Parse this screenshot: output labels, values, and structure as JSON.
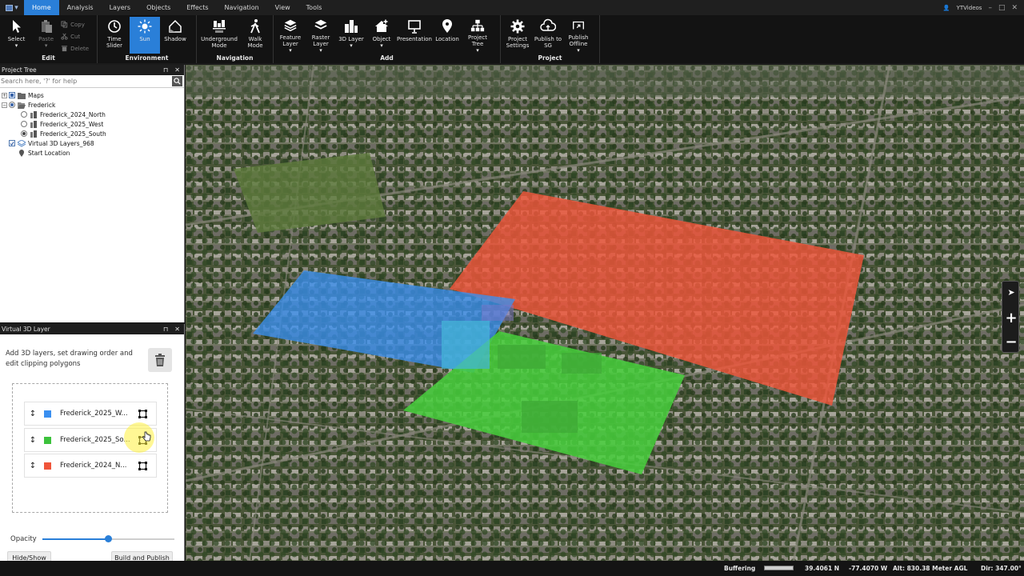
{
  "menu": {
    "tabs": [
      "Home",
      "Analysis",
      "Layers",
      "Objects",
      "Effects",
      "Navigation",
      "View",
      "Tools"
    ],
    "user": "YTVideos"
  },
  "ribbon": {
    "edit": {
      "label": "Edit",
      "select": "Select",
      "paste": "Paste",
      "copy": "Copy",
      "cut": "Cut",
      "delete": "Delete"
    },
    "environment": {
      "label": "Environment",
      "time_slider": "Time Slider",
      "sun": "Sun",
      "shadow": "Shadow"
    },
    "navigation": {
      "label": "Navigation",
      "underground": "Underground Mode",
      "walk": "Walk Mode"
    },
    "add": {
      "label": "Add",
      "feature_layer": "Feature Layer",
      "raster_layer": "Raster Layer",
      "layer_3d": "3D Layer",
      "object": "Object",
      "presentation": "Presentation",
      "location": "Location",
      "project_tree": "Project Tree"
    },
    "project": {
      "label": "Project",
      "settings": "Project Settings",
      "publish_sg": "Publish to SG",
      "publish_offline": "Publish Offline"
    }
  },
  "project_tree": {
    "title": "Project Tree",
    "search_placeholder": "Search here, '?' for help",
    "items": [
      {
        "label": "Maps"
      },
      {
        "label": "Frederick"
      },
      {
        "label": "Frederick_2024_North"
      },
      {
        "label": "Frederick_2025_West"
      },
      {
        "label": "Frederick_2025_South"
      },
      {
        "label": "Virtual 3D Layers_968"
      },
      {
        "label": "Start Location"
      }
    ]
  },
  "virtual_layer": {
    "title": "Virtual 3D Layer",
    "description": "Add 3D layers, set drawing order and edit clipping polygons",
    "layers": [
      {
        "name": "Frederick_2025_W...",
        "color": "#3a8ff0"
      },
      {
        "name": "Frederick_2025_So...",
        "color": "#3cc23c"
      },
      {
        "name": "Frederick_2024_N...",
        "color": "#f0553a"
      }
    ],
    "opacity_label": "Opacity",
    "opacity_value": 0.5,
    "hide_show": "Hide/Show",
    "build_publish": "Build and Publish"
  },
  "status": {
    "buffering": "Buffering",
    "lat": "39.4061 N",
    "lon": "-77.4070 W",
    "alt": "Alt: 830.38 Meter AGL",
    "dir": "Dir: 347.00°"
  }
}
